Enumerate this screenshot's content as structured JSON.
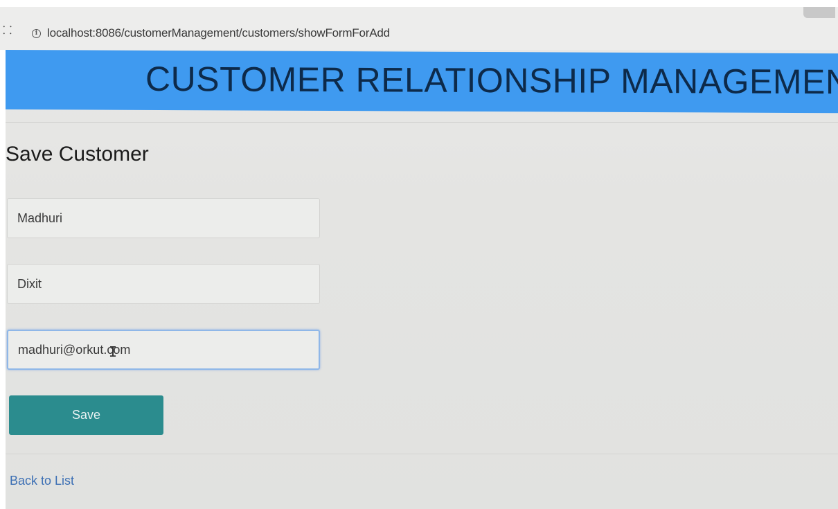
{
  "browser": {
    "url": "localhost:8086/customerManagement/customers/showFormForAdd",
    "info_icon": "info-icon"
  },
  "header": {
    "title": "CUSTOMER RELATIONSHIP MANAGEMENT",
    "background_color": "#3f9af0",
    "text_color": "#0d2a4a"
  },
  "form": {
    "heading": "Save Customer",
    "first_name_value": "Madhuri",
    "last_name_value": "Dixit",
    "email_value": "madhuri@orkut.com",
    "save_label": "Save",
    "save_color": "#2b8c8e"
  },
  "footer": {
    "back_link_label": "Back to List"
  }
}
